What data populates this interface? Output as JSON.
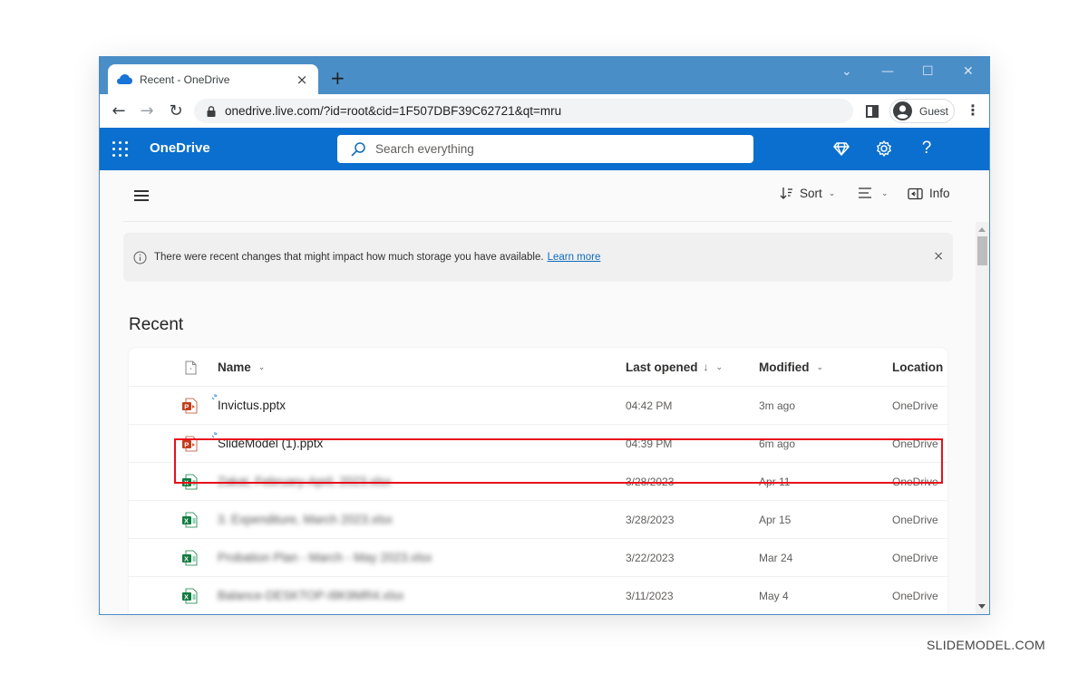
{
  "browser": {
    "tab_title": "Recent - OneDrive",
    "tab_close": "×",
    "new_tab": "+",
    "window_controls": {
      "tab_search": "⌄",
      "minimize": "—",
      "maximize": "☐",
      "close": "✕"
    },
    "nav": {
      "back": "←",
      "forward": "→",
      "reload": "↻"
    },
    "url": "onedrive.live.com/?id=root&cid=1F507DBF39C62721&qt=mru",
    "profile_name": "Guest",
    "menu": "⋮"
  },
  "app": {
    "brand": "OneDrive",
    "search_placeholder": "Search everything",
    "header_icons": [
      "premium-diamond-icon",
      "settings-gear-icon",
      "help-icon"
    ],
    "help_glyph": "?",
    "accent_color": "#0a6fce"
  },
  "command_bar": {
    "sort_label": "Sort",
    "view_label": "",
    "info_label": "Info"
  },
  "banner": {
    "message": "There were recent changes that might impact how much storage you have available.",
    "link": "Learn more",
    "close": "×"
  },
  "section_title": "Recent",
  "table": {
    "columns": {
      "name": "Name",
      "last_opened": "Last opened",
      "last_opened_sort": "↓",
      "modified": "Modified",
      "location": "Location"
    },
    "rows": [
      {
        "type": "pptx",
        "name": "Invictus.pptx",
        "last_opened": "04:42 PM",
        "modified": "3m ago",
        "location": "OneDrive",
        "new": true,
        "highlighted": true,
        "blurred": false
      },
      {
        "type": "pptx",
        "name": "SlideModel (1).pptx",
        "last_opened": "04:39 PM",
        "modified": "6m ago",
        "location": "OneDrive",
        "new": true,
        "highlighted": false,
        "blurred": false
      },
      {
        "type": "xlsx",
        "name": "Zakat, February-April, 2023.xlsx",
        "last_opened": "3/28/2023",
        "modified": "Apr 11",
        "location": "OneDrive",
        "new": false,
        "highlighted": false,
        "blurred": true
      },
      {
        "type": "xlsx",
        "name": "3. Expenditure, March 2023.xlsx",
        "last_opened": "3/28/2023",
        "modified": "Apr 15",
        "location": "OneDrive",
        "new": false,
        "highlighted": false,
        "blurred": true
      },
      {
        "type": "xlsx",
        "name": "Probation Plan - March - May 2023.xlsx",
        "last_opened": "3/22/2023",
        "modified": "Mar 24",
        "location": "OneDrive",
        "new": false,
        "highlighted": false,
        "blurred": true
      },
      {
        "type": "xlsx",
        "name": "Balance-DESKTOP-I8K9MR4.xlsx",
        "last_opened": "3/11/2023",
        "modified": "May 4",
        "location": "OneDrive",
        "new": false,
        "highlighted": false,
        "blurred": true
      }
    ]
  },
  "watermark": "SLIDEMODEL.COM"
}
